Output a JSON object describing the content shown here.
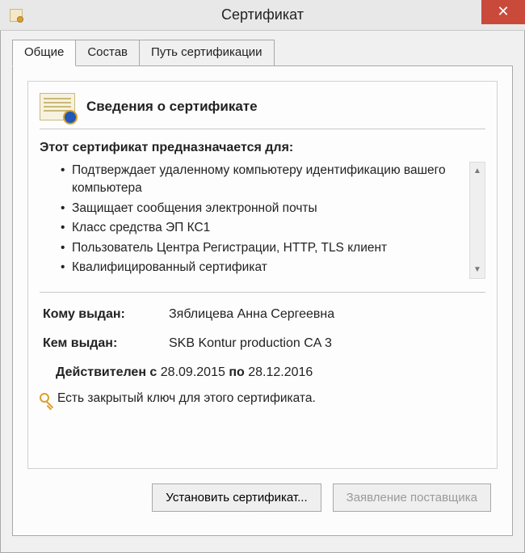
{
  "window": {
    "title": "Сертификат"
  },
  "tabs": {
    "general": "Общие",
    "composition": "Состав",
    "path": "Путь сертификации"
  },
  "cert": {
    "header": "Сведения о сертификате",
    "purposes_title": "Этот сертификат предназначается для:",
    "purposes": [
      "Подтверждает удаленному компьютеру идентификацию вашего компьютера",
      "Защищает сообщения электронной почты",
      "Класс средства ЭП КС1",
      "Пользователь Центра Регистрации, HTTP, TLS клиент",
      "Квалифицированный сертификат"
    ],
    "issued_to_label": "Кому выдан:",
    "issued_to": "Зяблицева Анна Сергеевна",
    "issued_by_label": "Кем выдан:",
    "issued_by": "SKB Kontur production CA 3",
    "valid_from_label": "Действителен с",
    "valid_from": "28.09.2015",
    "valid_to_label": "по",
    "valid_to": "28.12.2016",
    "private_key_msg": "Есть закрытый ключ для этого сертификата."
  },
  "buttons": {
    "install": "Установить сертификат...",
    "issuer_statement": "Заявление поставщика"
  }
}
